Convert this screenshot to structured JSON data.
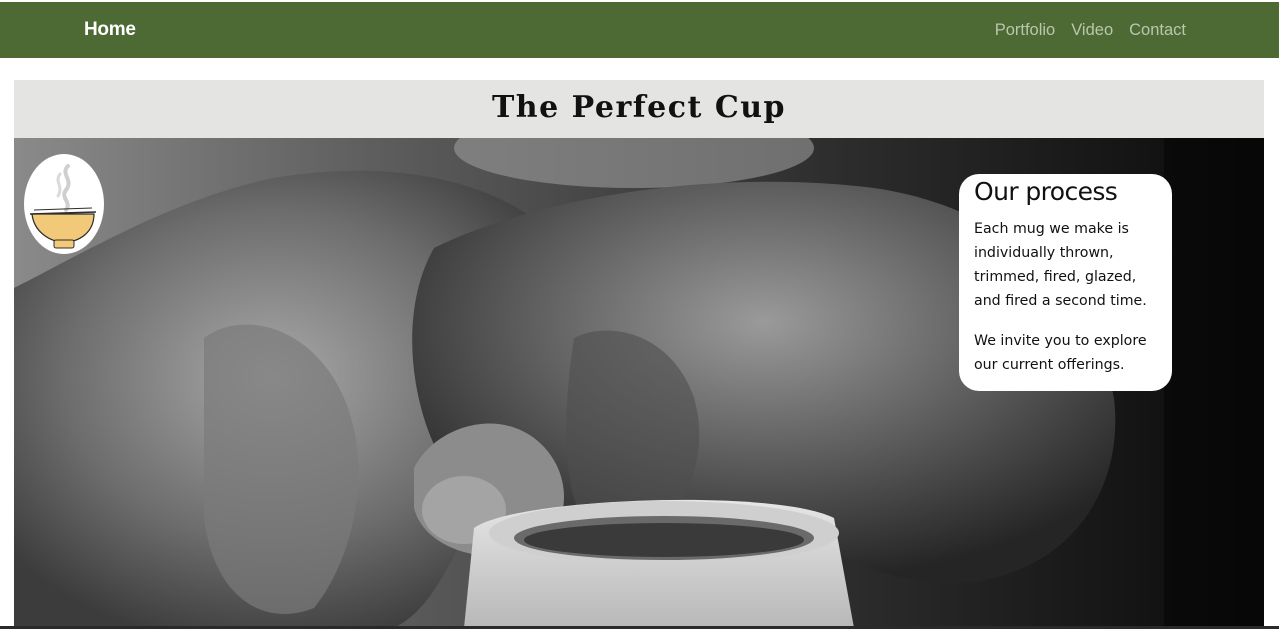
{
  "nav": {
    "home_label": "Home",
    "links": [
      {
        "label": "Portfolio"
      },
      {
        "label": "Video"
      },
      {
        "label": "Contact"
      }
    ],
    "background_color": "#4d6934"
  },
  "page": {
    "title": "The Perfect Cup"
  },
  "hero": {
    "image_icon": "pottery-wheel-hands-photo",
    "logo_icon": "steaming-bowl-logo-icon"
  },
  "process_card": {
    "heading": "Our process",
    "paragraphs": [
      "Each mug we make is individually thrown, trimmed, fired, glazed, and fired a second time.",
      "We invite you to explore our current offerings."
    ]
  }
}
